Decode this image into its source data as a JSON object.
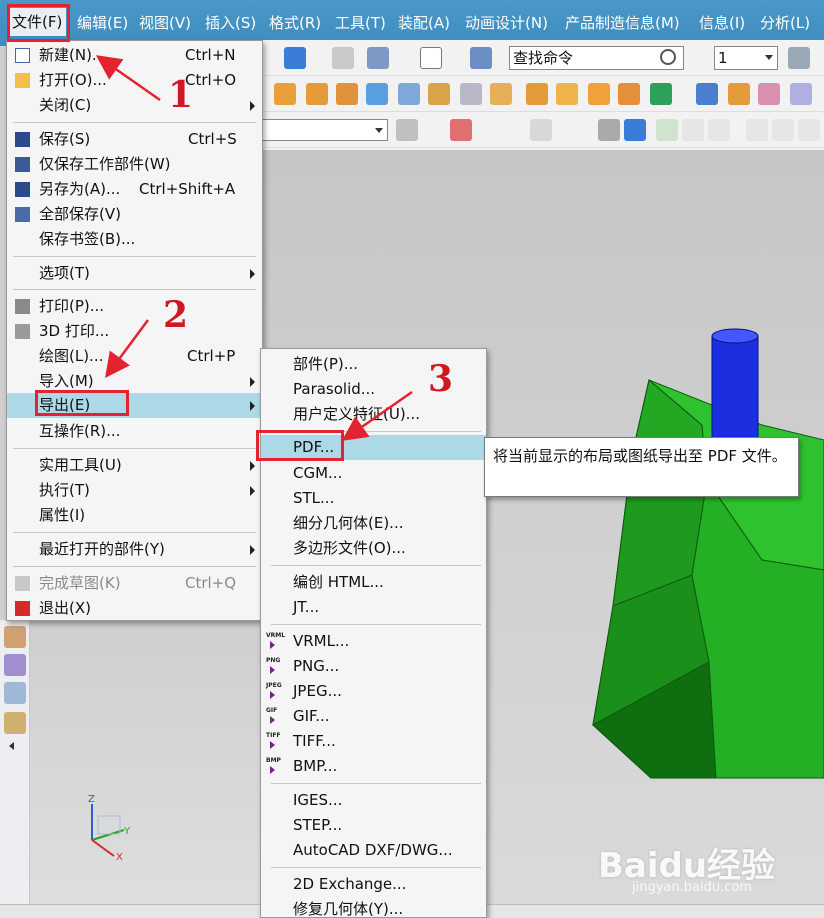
{
  "menubar": {
    "items": [
      "文件(F)",
      "编辑(E)",
      "视图(V)",
      "插入(S)",
      "格式(R)",
      "工具(T)",
      "装配(A)",
      "动画设计(N)",
      "产品制造信息(M)",
      "信息(I)",
      "分析(L)"
    ]
  },
  "toolbar": {
    "command_search": "查找命令",
    "layer_value": "1"
  },
  "file_menu": {
    "new": {
      "label": "新建(N)...",
      "shortcut": "Ctrl+N"
    },
    "open": {
      "label": "打开(O)...",
      "shortcut": "Ctrl+O"
    },
    "close": {
      "label": "关闭(C)"
    },
    "save": {
      "label": "保存(S)",
      "shortcut": "Ctrl+S"
    },
    "save_work_part": {
      "label": "仅保存工作部件(W)"
    },
    "save_as": {
      "label": "另存为(A)...",
      "shortcut": "Ctrl+Shift+A"
    },
    "save_all": {
      "label": "全部保存(V)"
    },
    "save_bookmark": {
      "label": "保存书签(B)..."
    },
    "options": {
      "label": "选项(T)"
    },
    "print": {
      "label": "打印(P)..."
    },
    "print_3d": {
      "label": "3D 打印..."
    },
    "plot": {
      "label": "绘图(L)...",
      "shortcut": "Ctrl+P"
    },
    "import": {
      "label": "导入(M)"
    },
    "export": {
      "label": "导出(E)"
    },
    "interop": {
      "label": "互操作(R)..."
    },
    "utilities": {
      "label": "实用工具(U)"
    },
    "execute": {
      "label": "执行(T)"
    },
    "properties": {
      "label": "属性(I)"
    },
    "recent": {
      "label": "最近打开的部件(Y)"
    },
    "finish_sketch": {
      "label": "完成草图(K)",
      "shortcut": "Ctrl+Q"
    },
    "exit": {
      "label": "退出(X)"
    }
  },
  "export_menu": {
    "items": [
      {
        "label": "部件(P)..."
      },
      {
        "label": "Parasolid..."
      },
      {
        "label": "用户定义特征(U)..."
      },
      {
        "label": "PDF..."
      },
      {
        "label": "CGM..."
      },
      {
        "label": "STL..."
      },
      {
        "label": "细分几何体(E)..."
      },
      {
        "label": "多边形文件(O)..."
      },
      {
        "label": "编创 HTML..."
      },
      {
        "label": "JT..."
      },
      {
        "label": "VRML...",
        "badge": "VRML"
      },
      {
        "label": "PNG...",
        "badge": "PNG"
      },
      {
        "label": "JPEG...",
        "badge": "JPEG"
      },
      {
        "label": "GIF...",
        "badge": "GIF"
      },
      {
        "label": "TIFF...",
        "badge": "TIFF"
      },
      {
        "label": "BMP...",
        "badge": "BMP"
      },
      {
        "label": "IGES..."
      },
      {
        "label": "STEP..."
      },
      {
        "label": "AutoCAD DXF/DWG..."
      },
      {
        "label": "2D Exchange..."
      },
      {
        "label": "修复几何体(Y)..."
      }
    ]
  },
  "tooltip": {
    "text": "将当前显示的布局或图纸导出至 PDF 文件。"
  },
  "annotations": {
    "step1": "1",
    "step2": "2",
    "step3": "3"
  },
  "axis": {
    "x": "X",
    "y": "Y",
    "z": "Z"
  },
  "watermark": {
    "brand": "Baidu经验",
    "url": "jingyan.baidu.com"
  },
  "colors": {
    "menubar": "#4590c2",
    "highlight": "#add8e6",
    "annotation_red": "#e3232f",
    "model_green": "#1fae1f",
    "model_blue": "#1b2ee0"
  }
}
